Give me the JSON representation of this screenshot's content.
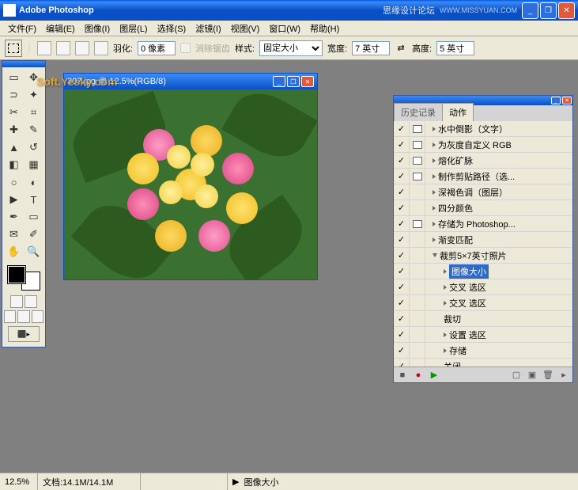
{
  "title": "Adobe Photoshop",
  "watermark_title": "思缘设计论坛",
  "watermark_url": "WWW.MISSYUAN.COM",
  "menu": [
    "文件(F)",
    "编辑(E)",
    "图像(I)",
    "图层(L)",
    "选择(S)",
    "滤镜(I)",
    "视图(V)",
    "窗口(W)",
    "帮助(H)"
  ],
  "options": {
    "feather_label": "羽化:",
    "feather_value": "0 像素",
    "antialias_label": "消除锯齿",
    "style_label": "样式:",
    "style_value": "固定大小",
    "width_label": "宽度:",
    "width_value": "7 英寸",
    "height_label": "高度:",
    "height_value": "5 英寸"
  },
  "doc": {
    "title": "307.jpg @ 12.5%(RGB/8)",
    "watermark": "Soft.Yesky.com"
  },
  "panel": {
    "tabs": [
      "历史记录",
      "动作"
    ],
    "active_tab": 1,
    "actions": [
      {
        "chk": true,
        "dlg": true,
        "indent": 0,
        "tri": "r",
        "label": "水中倒影（文字）"
      },
      {
        "chk": true,
        "dlg": true,
        "indent": 0,
        "tri": "r",
        "label": "为灰度自定义 RGB"
      },
      {
        "chk": true,
        "dlg": true,
        "indent": 0,
        "tri": "r",
        "label": "熔化矿脉"
      },
      {
        "chk": true,
        "dlg": true,
        "indent": 0,
        "tri": "r",
        "label": "制作剪贴路径（选..."
      },
      {
        "chk": true,
        "dlg": false,
        "indent": 0,
        "tri": "r",
        "label": "深褐色调（图层）"
      },
      {
        "chk": true,
        "dlg": false,
        "indent": 0,
        "tri": "r",
        "label": "四分颜色"
      },
      {
        "chk": true,
        "dlg": true,
        "indent": 0,
        "tri": "r",
        "label": "存储为 Photoshop..."
      },
      {
        "chk": true,
        "dlg": false,
        "indent": 0,
        "tri": "r",
        "label": "渐变匹配"
      },
      {
        "chk": true,
        "dlg": false,
        "indent": 0,
        "tri": "d",
        "label": "裁剪5×7英寸照片"
      },
      {
        "chk": true,
        "dlg": false,
        "indent": 1,
        "tri": "r",
        "label": "图像大小",
        "sel": true
      },
      {
        "chk": true,
        "dlg": false,
        "indent": 1,
        "tri": "r",
        "label": "交叉 选区"
      },
      {
        "chk": true,
        "dlg": false,
        "indent": 1,
        "tri": "r",
        "label": "交叉 选区"
      },
      {
        "chk": true,
        "dlg": false,
        "indent": 1,
        "tri": "",
        "label": "裁切"
      },
      {
        "chk": true,
        "dlg": false,
        "indent": 1,
        "tri": "r",
        "label": "设置 选区"
      },
      {
        "chk": true,
        "dlg": false,
        "indent": 1,
        "tri": "r",
        "label": "存储"
      },
      {
        "chk": true,
        "dlg": false,
        "indent": 1,
        "tri": "",
        "label": "关闭"
      }
    ]
  },
  "status": {
    "zoom": "12.5%",
    "doc_size": "文档:14.1M/14.1M",
    "action": "图像大小"
  }
}
